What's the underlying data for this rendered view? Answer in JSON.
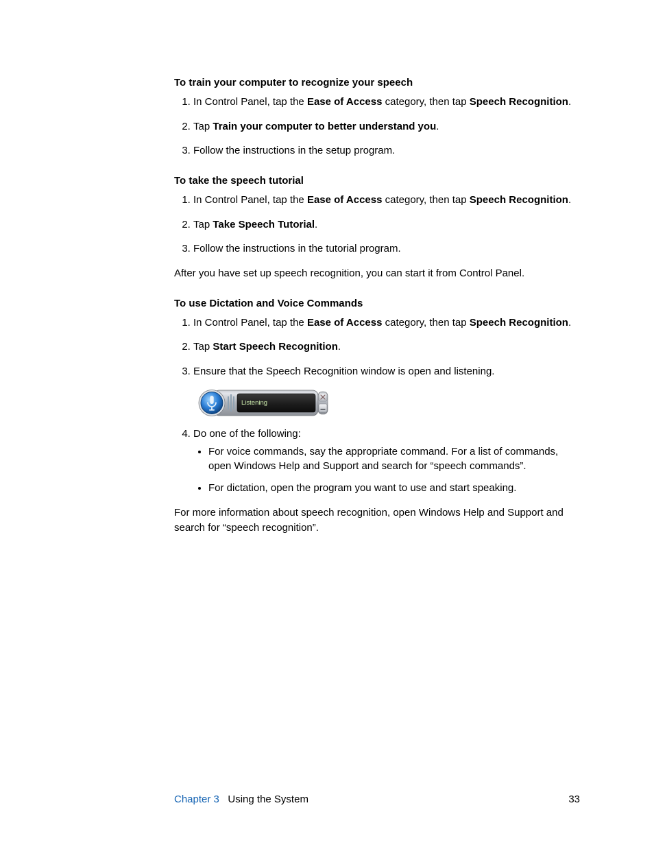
{
  "sections": {
    "train": {
      "heading": "To train your computer to recognize your speech",
      "step1_pre": "In Control Panel, tap the ",
      "step1_b1": "Ease of Access",
      "step1_mid": " category, then tap ",
      "step1_b2": "Speech Recognition",
      "step1_post": ".",
      "step2_pre": "Tap ",
      "step2_b": "Train your computer to better understand you",
      "step2_post": ".",
      "step3": "Follow the instructions in the setup program."
    },
    "tutorial": {
      "heading": "To take the speech tutorial",
      "step1_pre": "In Control Panel, tap the ",
      "step1_b1": "Ease of Access",
      "step1_mid": " category, then tap ",
      "step1_b2": "Speech Recognition",
      "step1_post": ".",
      "step2_pre": "Tap ",
      "step2_b": "Take Speech Tutorial",
      "step2_post": ".",
      "step3": "Follow the instructions in the tutorial program.",
      "after": "After you have set up speech recognition, you can start it from Control Panel."
    },
    "use": {
      "heading": "To use Dictation and Voice Commands",
      "step1_pre": "In Control Panel, tap the ",
      "step1_b1": "Ease of Access",
      "step1_mid": " category, then tap ",
      "step1_b2": "Speech Recognition",
      "step1_post": ".",
      "step2_pre": "Tap ",
      "step2_b": "Start Speech Recognition",
      "step2_post": ".",
      "step3": "Ensure that the Speech Recognition window is open and listening.",
      "widget_label": "Listening",
      "step4": "Do one of the following:",
      "sub1": "For voice commands, say the appropriate command. For a list of commands, open Windows Help and Support and search for “speech commands”.",
      "sub2": "For dictation, open the program you want to use and start speaking.",
      "more": "For more information about speech recognition, open Windows Help and Support and search for “speech recognition”."
    }
  },
  "footer": {
    "chapter": "Chapter 3",
    "title": "Using the System",
    "page": "33"
  }
}
